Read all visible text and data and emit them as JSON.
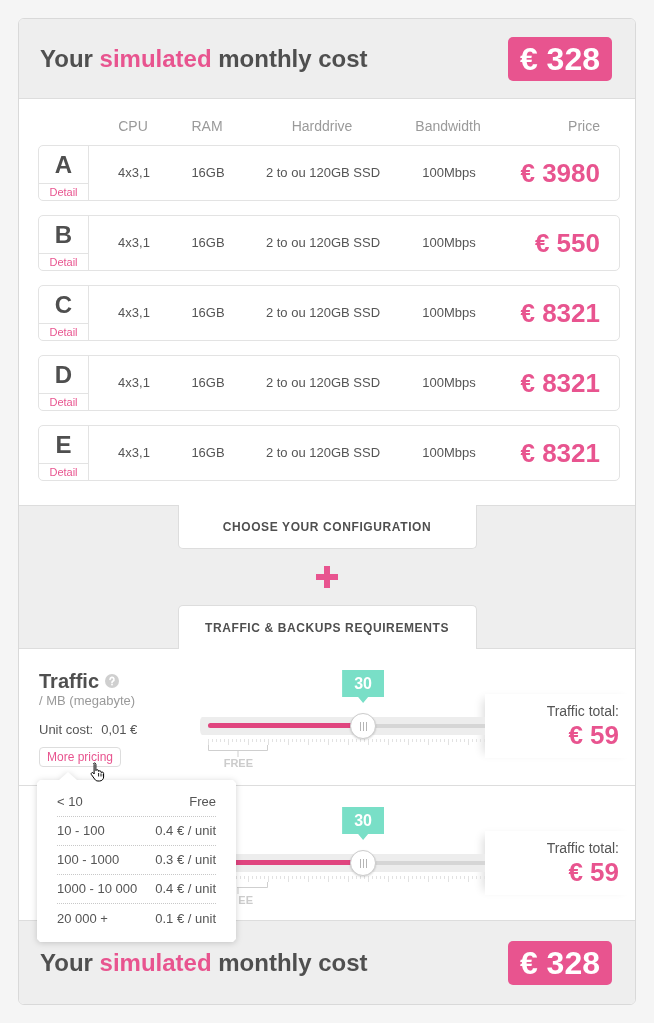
{
  "header": {
    "title": [
      {
        "text": "Your ",
        "highlight": false
      },
      {
        "text": "simulated",
        "highlight": true
      },
      {
        "text": " monthly cost",
        "highlight": false
      }
    ],
    "total": "€ 328"
  },
  "table": {
    "columns": [
      "CPU",
      "RAM",
      "Harddrive",
      "Bandwidth",
      "Price"
    ],
    "rows": [
      {
        "plan": "A",
        "detail": "Detail",
        "cpu": "4x3,1",
        "ram": "16GB",
        "harddrive": "2 to ou 120GB SSD",
        "bandwidth": "100Mbps",
        "price": "€ 3980"
      },
      {
        "plan": "B",
        "detail": "Detail",
        "cpu": "4x3,1",
        "ram": "16GB",
        "harddrive": "2 to ou 120GB SSD",
        "bandwidth": "100Mbps",
        "price": "€ 550"
      },
      {
        "plan": "C",
        "detail": "Detail",
        "cpu": "4x3,1",
        "ram": "16GB",
        "harddrive": "2 to ou 120GB SSD",
        "bandwidth": "100Mbps",
        "price": "€ 8321"
      },
      {
        "plan": "D",
        "detail": "Detail",
        "cpu": "4x3,1",
        "ram": "16GB",
        "harddrive": "2 to ou 120GB SSD",
        "bandwidth": "100Mbps",
        "price": "€ 8321"
      },
      {
        "plan": "E",
        "detail": "Detail",
        "cpu": "4x3,1",
        "ram": "16GB",
        "harddrive": "2 to ou 120GB SSD",
        "bandwidth": "100Mbps",
        "price": "€ 8321"
      }
    ]
  },
  "configuration_tab": "CHOOSE YOUR CONFIGURATION",
  "traffic_tab": "TRAFFIC & BACKUPS REQUIREMENTS",
  "traffic_rows": [
    {
      "title": "Traffic",
      "unit": "/ MB (megabyte)",
      "unit_cost_label": "Unit cost:",
      "unit_cost": "0,01 €",
      "more_pricing": "More pricing",
      "slider_value": "30",
      "level": 0.56,
      "free_label": "FREE",
      "total_label": "Traffic total:",
      "total": "€ 59"
    },
    {
      "slider_value": "30",
      "level": 0.56,
      "free_label": "EE",
      "total_label": "Traffic total:",
      "total": "€ 59"
    }
  ],
  "pricing_popover": [
    {
      "range": "< 10",
      "price": "Free"
    },
    {
      "range": "10 - 100",
      "price": "0.4 € / unit"
    },
    {
      "range": "100 - 1000",
      "price": "0.3 € / unit"
    },
    {
      "range": "1000 - 10 000",
      "price": "0.4 € / unit"
    },
    {
      "range": "20 000 +",
      "price": "0.1 € / unit"
    }
  ],
  "footer": {
    "title": [
      {
        "text": "Your ",
        "highlight": false
      },
      {
        "text": "simulated",
        "highlight": true
      },
      {
        "text": " monthly cost",
        "highlight": false
      }
    ],
    "total": "€ 328"
  }
}
